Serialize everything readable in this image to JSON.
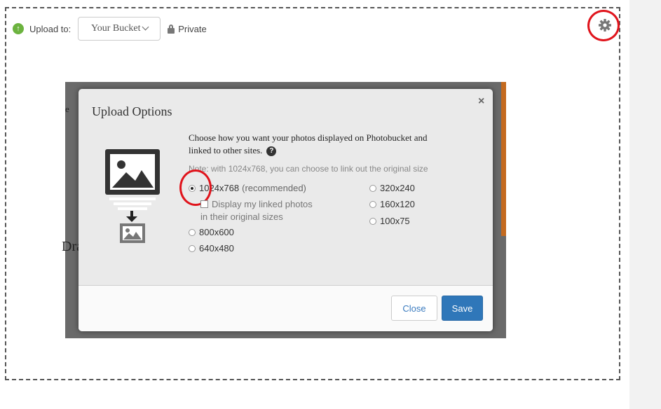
{
  "toolbar": {
    "upload_label": "Upload to:",
    "bucket_value": "Your Bucket",
    "privacy_label": "Private",
    "settings_icon": "gear-icon"
  },
  "background": {
    "text_fragment_1": "e",
    "text_fragment_2": "Dra"
  },
  "modal": {
    "title": "Upload Options",
    "close_symbol": "×",
    "description": "Choose how you want your photos displayed on Photobucket and linked to other sites.",
    "help_symbol": "?",
    "note": "Note: with 1024x768, you can choose to link out the original size",
    "options_left": [
      {
        "label": "1024x768",
        "suffix": "(recommended)",
        "selected": true
      },
      {
        "label": "800x600",
        "selected": false
      },
      {
        "label": "640x480",
        "selected": false
      }
    ],
    "checkbox_label": "Display my linked photos",
    "checkbox_sublabel": "in their original sizes",
    "options_right": [
      {
        "label": "320x240",
        "selected": false
      },
      {
        "label": "160x120",
        "selected": false
      },
      {
        "label": "100x75",
        "selected": false
      }
    ],
    "buttons": {
      "close": "Close",
      "save": "Save"
    }
  },
  "colors": {
    "accent_green": "#6cb33f",
    "save_blue": "#2f77b9",
    "annotation_red": "#e0141c"
  }
}
